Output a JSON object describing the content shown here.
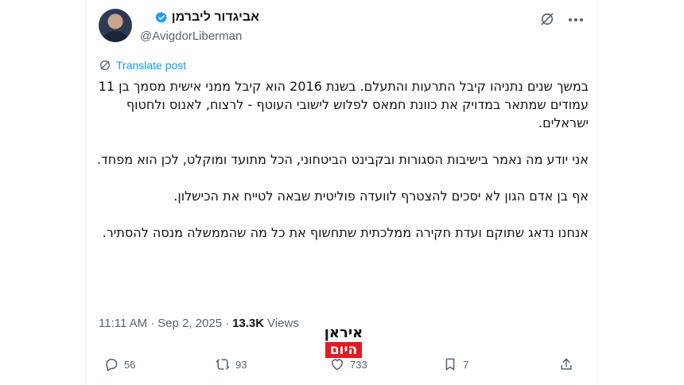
{
  "author": {
    "display_name": "אביגדור ליברמן",
    "handle": "@AvigdorLiberman",
    "verified_badge_color": "#1d9bf0"
  },
  "toolbar": {
    "grok_icon": "grok-icon",
    "more_icon": "more-icon"
  },
  "translate": {
    "label": "Translate post",
    "icon": "translate-icon"
  },
  "post": {
    "paragraphs": [
      "במשך שנים נתניהו קיבל התרעות והתעלם. בשנת 2016 הוא קיבל ממני אישית מסמך בן 11 עמודים שמתאר במדויק את כוונת חמאס לפלוש לישובי העוטף - לרצוח, לאנוס ולחטוף ישראלים.",
      "אני יודע מה נאמר בישיבות הסגורות ובקבינט הביטחוני, הכל מתועד ומוקלט, לכן הוא מפחד.",
      "אף בן אדם הגון לא יסכים להצטרף לוועדה פוליטית שבאה לטייח את הכישלון.",
      "אנחנו נדאג שתוקם ועדת חקירה ממלכתית שתחשוף את כל מה שהממשלה מנסה להסתיר."
    ]
  },
  "meta": {
    "time": "11:11 AM",
    "separator": "·",
    "date": "Sep 2, 2025",
    "views_count": "13.3K",
    "views_label": "Views"
  },
  "watermark": {
    "top": "איראן",
    "bottom": "היום",
    "accent": "#e21b23"
  },
  "actions": {
    "replies": "56",
    "reposts": "93",
    "likes": "733",
    "bookmarks": "7"
  }
}
